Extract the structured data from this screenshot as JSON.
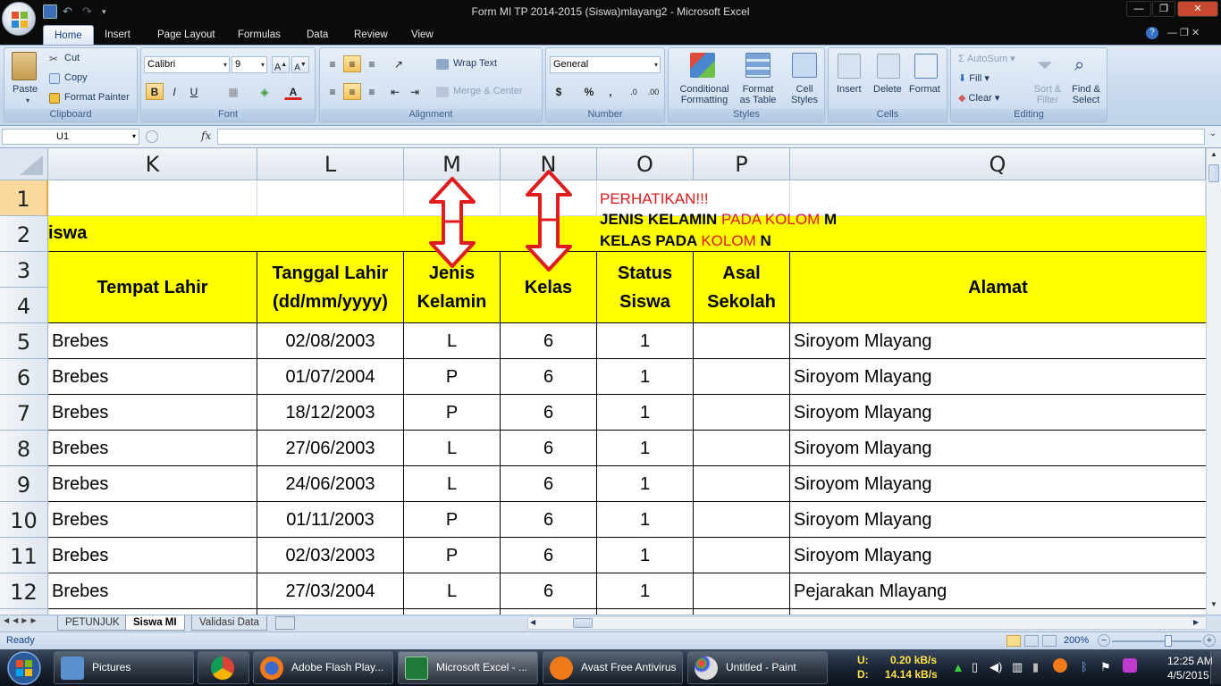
{
  "window": {
    "title": "Form MI TP 2014-2015 (Siswa)mlayang2 - Microsoft Excel",
    "icon_name": "office-button-icon"
  },
  "tabs": [
    "Home",
    "Insert",
    "Page Layout",
    "Formulas",
    "Data",
    "Review",
    "View"
  ],
  "ribbon": {
    "clipboard": {
      "label": "Clipboard",
      "paste": "Paste",
      "cut": "Cut",
      "copy": "Copy",
      "format_painter": "Format Painter"
    },
    "font": {
      "label": "Font",
      "font_name": "Calibri",
      "font_size": "9",
      "bold": "B",
      "italic": "I",
      "underline": "U"
    },
    "alignment": {
      "label": "Alignment",
      "wrap_text": "Wrap Text",
      "merge_center": "Merge & Center"
    },
    "number": {
      "label": "Number",
      "format": "General",
      "currency": "$",
      "percent": "%",
      "comma": ","
    },
    "styles": {
      "label": "Styles",
      "conditional_formatting": "Conditional Formatting",
      "format_as_table": "Format as Table",
      "cell_styles": "Cell Styles"
    },
    "cells": {
      "label": "Cells",
      "insert": "Insert",
      "delete": "Delete",
      "format": "Format"
    },
    "editing": {
      "label": "Editing",
      "autosum": "AutoSum",
      "fill": "Fill",
      "clear": "Clear",
      "sort_filter": "Sort & Filter",
      "find_select": "Find & Select"
    }
  },
  "formula_bar": {
    "name_box": "U1",
    "fx": "fx",
    "formula": ""
  },
  "columns": [
    "K",
    "L",
    "M",
    "N",
    "O",
    "P",
    "Q"
  ],
  "rows": [
    "1",
    "2",
    "3",
    "4",
    "5",
    "6",
    "7",
    "8",
    "9",
    "10",
    "11",
    "12"
  ],
  "sheet": {
    "row2_text": "iswa",
    "note": {
      "line1": "PERHATIKAN!!!",
      "line2_a": "JENIS KELAMIN ",
      "line2_b": "PADA KOLOM ",
      "line2_c": "M",
      "line3_a": "KELAS PADA ",
      "line3_b": "KOLOM ",
      "line3_c": "N"
    },
    "headers": {
      "tempat_lahir": "Tempat Lahir",
      "tanggal_lahir_1": "Tanggal Lahir",
      "tanggal_lahir_2": "(dd/mm/yyyy)",
      "jenis_1": "Jenis",
      "jenis_2": "Kelamin",
      "kelas": "Kelas",
      "status_1": "Status",
      "status_2": "Siswa",
      "asal_1": "Asal",
      "asal_2": "Sekolah",
      "alamat": "Alamat"
    },
    "data": [
      {
        "tempat": "Brebes",
        "tanggal": "02/08/2003",
        "jk": "L",
        "kelas": "6",
        "status": "1",
        "asal": "",
        "alamat": "Siroyom Mlayang"
      },
      {
        "tempat": "Brebes",
        "tanggal": "01/07/2004",
        "jk": "P",
        "kelas": "6",
        "status": "1",
        "asal": "",
        "alamat": "Siroyom Mlayang"
      },
      {
        "tempat": "Brebes",
        "tanggal": "18/12/2003",
        "jk": "P",
        "kelas": "6",
        "status": "1",
        "asal": "",
        "alamat": "Siroyom Mlayang"
      },
      {
        "tempat": "Brebes",
        "tanggal": "27/06/2003",
        "jk": "L",
        "kelas": "6",
        "status": "1",
        "asal": "",
        "alamat": "Siroyom Mlayang"
      },
      {
        "tempat": "Brebes",
        "tanggal": "24/06/2003",
        "jk": "L",
        "kelas": "6",
        "status": "1",
        "asal": "",
        "alamat": "Siroyom Mlayang"
      },
      {
        "tempat": "Brebes",
        "tanggal": "01/11/2003",
        "jk": "P",
        "kelas": "6",
        "status": "1",
        "asal": "",
        "alamat": "Siroyom Mlayang"
      },
      {
        "tempat": "Brebes",
        "tanggal": "02/03/2003",
        "jk": "P",
        "kelas": "6",
        "status": "1",
        "asal": "",
        "alamat": "Siroyom Mlayang"
      },
      {
        "tempat": "Brebes",
        "tanggal": "27/03/2004",
        "jk": "L",
        "kelas": "6",
        "status": "1",
        "asal": "",
        "alamat": "Pejarakan Mlayang"
      }
    ]
  },
  "sheet_tabs": [
    "PETUNJUK",
    "Siswa MI",
    "Validasi Data"
  ],
  "status": {
    "ready": "Ready",
    "zoom": "200%"
  },
  "taskbar": {
    "items": [
      "Pictures",
      "Adobe Flash Play...",
      "Microsoft Excel - ...",
      "Avast Free Antivirus",
      "Untitled - Paint"
    ],
    "net_u_label": "U:",
    "net_u": "0.20 kB/s",
    "net_d_label": "D:",
    "net_d": "14.14 kB/s",
    "time": "12:25 AM",
    "date": "4/5/2015"
  },
  "colors": {
    "accent_red": "#e01b1b",
    "yellow": "#ffff00",
    "selected_row": "#f9d99e"
  }
}
